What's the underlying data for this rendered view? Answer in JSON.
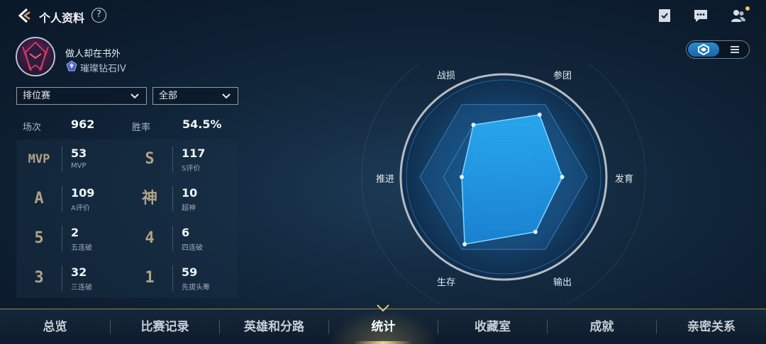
{
  "header": {
    "title": "个人资料",
    "help_icon": "help-icon",
    "icons": [
      "task-checklist-icon",
      "chat-bubble-icon",
      "friends-icon"
    ]
  },
  "profile": {
    "name": "做人却在书外",
    "rank": "璀璨钻石IV"
  },
  "filters": {
    "mode": "排位赛",
    "scope": "全部"
  },
  "summary": {
    "matches_label": "场次",
    "matches_value": "962",
    "winrate_label": "胜率",
    "winrate_value": "54.5%"
  },
  "stats": [
    {
      "badge": "MVP",
      "value": "53",
      "label": "MVP"
    },
    {
      "badge": "S",
      "value": "117",
      "label": "S评价"
    },
    {
      "badge": "A",
      "value": "109",
      "label": "A评价"
    },
    {
      "badge": "神",
      "value": "10",
      "label": "超神"
    },
    {
      "badge": "5",
      "value": "2",
      "label": "五连破"
    },
    {
      "badge": "4",
      "value": "6",
      "label": "四连破"
    },
    {
      "badge": "3",
      "value": "32",
      "label": "三连破"
    },
    {
      "badge": "1",
      "value": "59",
      "label": "先拔头筹"
    }
  ],
  "radar": {
    "axes": [
      "参团",
      "发育",
      "输出",
      "生存",
      "推进",
      "战损"
    ],
    "values": [
      0.86,
      0.7,
      0.76,
      0.93,
      0.5,
      0.72
    ]
  },
  "view_toggle": {
    "active": "radar",
    "icons": [
      "radar-view-icon",
      "list-view-icon"
    ]
  },
  "nav": {
    "tabs": [
      "总览",
      "比赛记录",
      "英雄和分路",
      "统计",
      "收藏室",
      "成就",
      "亲密关系"
    ],
    "active_index": 3
  },
  "colors": {
    "accent_gold": "#d6b86a",
    "radar_fill": "#1fa6f0",
    "background": "#132a40"
  }
}
